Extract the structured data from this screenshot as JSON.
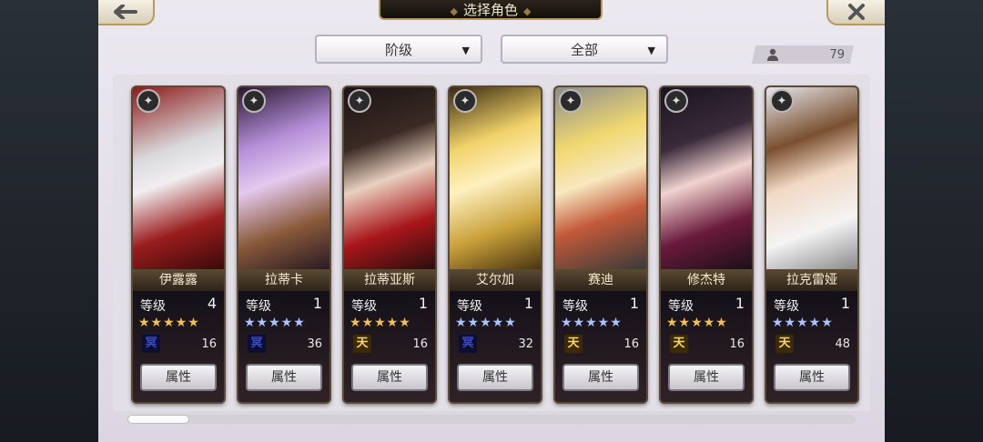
{
  "header": {
    "title": "选择角色",
    "back_icon": "arrow-left-icon",
    "close_icon": "close-icon"
  },
  "filters": {
    "grade_label": "阶级",
    "category_label": "全部"
  },
  "count": {
    "value": "79",
    "icon": "person-icon"
  },
  "cards": [
    {
      "name": "伊露露",
      "level_label": "等级",
      "level": "4",
      "stars": 5,
      "star_color": "gold",
      "badge": "冥",
      "badge_type": "dark",
      "number": "16",
      "button": "属性",
      "class_icon": "axe-icon"
    },
    {
      "name": "拉蒂卡",
      "level_label": "等级",
      "level": "1",
      "stars": 5,
      "star_color": "blue",
      "badge": "冥",
      "badge_type": "dark",
      "number": "36",
      "button": "属性",
      "class_icon": "staff-icon"
    },
    {
      "name": "拉蒂亚斯",
      "level_label": "等级",
      "level": "1",
      "stars": 5,
      "star_color": "gold",
      "badge": "天",
      "badge_type": "sky",
      "number": "16",
      "button": "属性",
      "class_icon": "sword-icon"
    },
    {
      "name": "艾尔加",
      "level_label": "等级",
      "level": "1",
      "stars": 5,
      "star_color": "blue",
      "badge": "冥",
      "badge_type": "dark",
      "number": "32",
      "button": "属性",
      "class_icon": "sword-icon"
    },
    {
      "name": "赛迪",
      "level_label": "等级",
      "level": "1",
      "stars": 5,
      "star_color": "blue",
      "badge": "天",
      "badge_type": "sky",
      "number": "16",
      "button": "属性",
      "class_icon": "arrow-icon"
    },
    {
      "name": "修杰特",
      "level_label": "等级",
      "level": "1",
      "stars": 5,
      "star_color": "gold",
      "badge": "天",
      "badge_type": "sky",
      "number": "16",
      "button": "属性",
      "class_icon": "bow-icon"
    },
    {
      "name": "拉克雷娅",
      "level_label": "等级",
      "level": "1",
      "stars": 5,
      "star_color": "blue",
      "badge": "天",
      "badge_type": "sky",
      "number": "48",
      "button": "属性",
      "class_icon": "crossbow-icon"
    }
  ],
  "colors": {
    "star_gold": "#f2c24a",
    "star_blue": "#a9c4ff",
    "frame": "#5a4a3a"
  }
}
